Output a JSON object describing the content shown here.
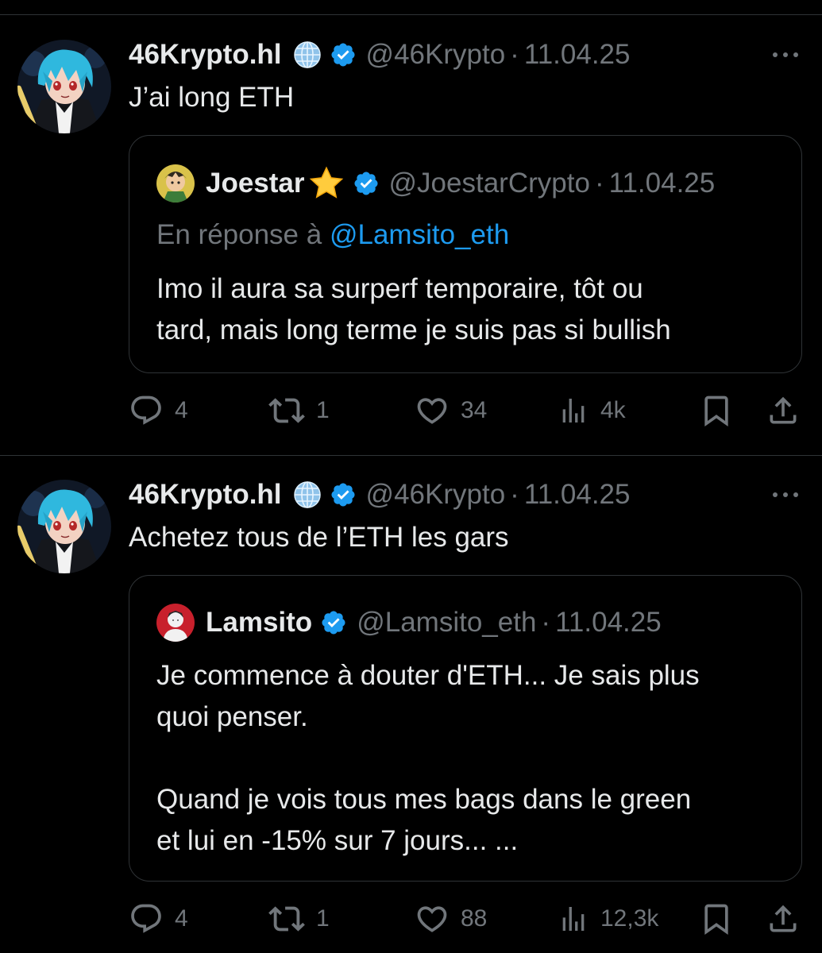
{
  "tweets": [
    {
      "author": {
        "name": "46Krypto.hl",
        "handle": "@46Krypto",
        "date": "11.04.25"
      },
      "text": "J’ai long ETH",
      "quote": {
        "author": {
          "name": "Joestar",
          "handle": "@JoestarCrypto",
          "date": "11.04.25"
        },
        "reply_prefix": "En réponse à",
        "reply_mention": "@Lamsito_eth",
        "lines": [
          "Imo il aura sa surperf temporaire, tôt ou",
          "tard, mais long terme je suis pas si bullish"
        ]
      },
      "stats": {
        "replies": "4",
        "reposts": "1",
        "likes": "34",
        "views": "4k"
      }
    },
    {
      "author": {
        "name": "46Krypto.hl",
        "handle": "@46Krypto",
        "date": "11.04.25"
      },
      "text": "Achetez tous de l’ETH les gars",
      "quote": {
        "author": {
          "name": "Lamsito",
          "handle": "@Lamsito_eth",
          "date": "11.04.25"
        },
        "lines": [
          "Je commence à douter d'ETH... Je sais plus",
          "quoi penser.",
          "Quand je vois tous mes bags dans le green",
          "et lui en -15% sur 7 jours... ..."
        ]
      },
      "stats": {
        "replies": "4",
        "reposts": "1",
        "likes": "88",
        "views": "12,3k"
      }
    }
  ],
  "colors": {
    "background": "#000000",
    "text": "#e7e9ea",
    "muted": "#71767b",
    "border": "#2f3336",
    "link": "#1d9bf0",
    "verified": "#1d9bf0"
  },
  "icons": {
    "globe": "globe-icon",
    "verified": "verified-badge-icon",
    "star": "star-emoji-icon",
    "reply": "reply-icon",
    "repost": "repost-icon",
    "like": "heart-icon",
    "views": "views-icon",
    "bookmark": "bookmark-icon",
    "share": "share-icon"
  }
}
